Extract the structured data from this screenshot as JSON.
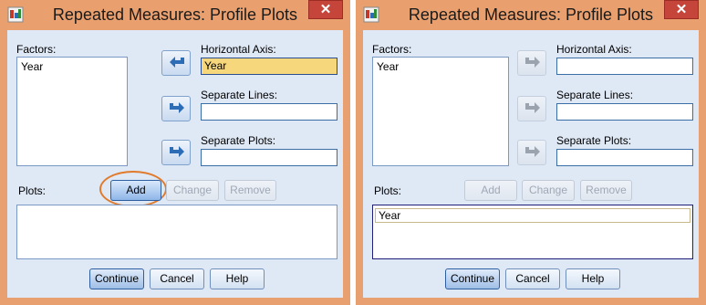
{
  "left": {
    "title": "Repeated Measures: Profile Plots",
    "close": "✕",
    "factors_label": "Factors:",
    "factors_items": [
      "Year"
    ],
    "horizontal_axis_label": "Horizontal Axis:",
    "horizontal_axis_value": "Year",
    "separate_lines_label": "Separate Lines:",
    "separate_lines_value": "",
    "separate_plots_label": "Separate Plots:",
    "separate_plots_value": "",
    "plots_label": "Plots:",
    "add_label": "Add",
    "change_label": "Change",
    "remove_label": "Remove",
    "plots_items": [],
    "continue_label": "Continue",
    "cancel_label": "Cancel",
    "help_label": "Help"
  },
  "right": {
    "title": "Repeated Measures: Profile Plots",
    "close": "✕",
    "factors_label": "Factors:",
    "factors_items": [
      "Year"
    ],
    "horizontal_axis_label": "Horizontal Axis:",
    "horizontal_axis_value": "",
    "separate_lines_label": "Separate Lines:",
    "separate_lines_value": "",
    "separate_plots_label": "Separate Plots:",
    "separate_plots_value": "",
    "plots_label": "Plots:",
    "add_label": "Add",
    "change_label": "Change",
    "remove_label": "Remove",
    "plots_items": [
      "Year"
    ],
    "continue_label": "Continue",
    "cancel_label": "Cancel",
    "help_label": "Help"
  },
  "colors": {
    "title_bar": "#e9a06e",
    "client": "#dfe8f5",
    "highlight_field": "#f7d77c",
    "annotation_circle": "#e07b2b"
  }
}
